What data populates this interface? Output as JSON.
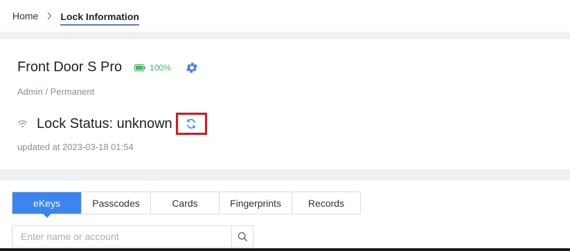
{
  "breadcrumb": {
    "home": "Home",
    "current": "Lock Information"
  },
  "lock": {
    "name": "Front Door S Pro",
    "battery": "100%",
    "role": "Admin / Permanent",
    "status": "Lock Status: unknown",
    "updated": "updated at 2023-03-18 01:54"
  },
  "tabs": [
    {
      "label": "eKeys",
      "active": true
    },
    {
      "label": "Passcodes",
      "active": false
    },
    {
      "label": "Cards",
      "active": false
    },
    {
      "label": "Fingerprints",
      "active": false
    },
    {
      "label": "Records",
      "active": false
    }
  ],
  "search": {
    "placeholder": "Enter name or account"
  },
  "colors": {
    "accent": "#3a86ee",
    "battery": "#3cbf5a",
    "highlight": "#e0141c"
  },
  "icons": {
    "separator": "chevron-right-icon",
    "battery": "battery-icon",
    "settings": "gear-icon",
    "wifi": "wifi-icon",
    "refresh": "refresh-icon",
    "search": "search-icon"
  }
}
